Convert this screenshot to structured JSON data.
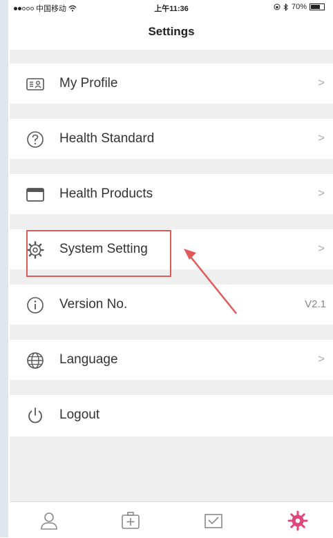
{
  "status_bar": {
    "carrier": "中国移动",
    "wifi": "wifi-icon",
    "time": "上午11:36",
    "battery_text": "70%",
    "battery_level": 0.7
  },
  "header": {
    "title": "Settings"
  },
  "menu": [
    {
      "label": "My Profile",
      "icon": "profile-card-icon",
      "accessory": ">"
    },
    {
      "label": "Health Standard",
      "icon": "question-icon",
      "accessory": ">"
    },
    {
      "label": "Health Products",
      "icon": "products-window-icon",
      "accessory": ">"
    },
    {
      "label": "System Setting",
      "icon": "gear-icon",
      "accessory": ">"
    },
    {
      "label": "Version No.",
      "icon": "info-icon",
      "value": "V2.1"
    },
    {
      "label": "Language",
      "icon": "globe-icon",
      "accessory": ">"
    },
    {
      "label": "Logout",
      "icon": "power-icon"
    }
  ],
  "tab_bar": {
    "items": [
      "person-icon",
      "medical-kit-icon",
      "message-icon",
      "settings-gear-icon"
    ],
    "active_index": 3,
    "active_color": "#e0457b",
    "inactive_color": "#888888"
  },
  "annotation": {
    "color": "#e05a5a"
  }
}
